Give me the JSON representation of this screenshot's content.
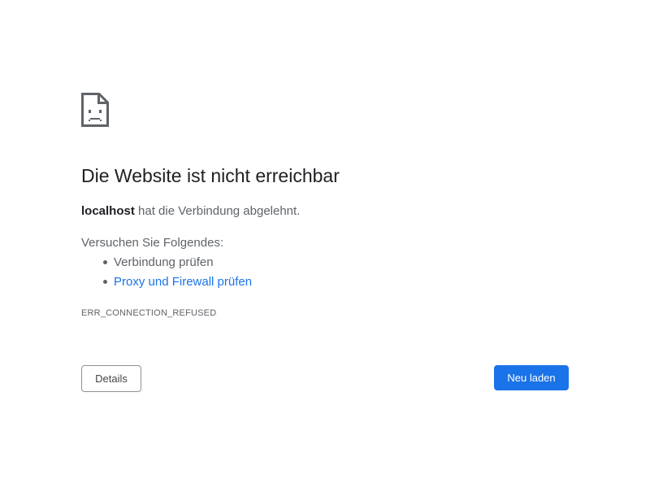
{
  "error_page": {
    "icon": "sad-document-icon",
    "title": "Die Website ist nicht erreichbar",
    "host": "localhost",
    "message_rest": " hat die Verbindung abgelehnt.",
    "suggestions_heading": "Versuchen Sie Folgendes:",
    "suggestions": [
      {
        "label": "Verbindung prüfen",
        "is_link": false
      },
      {
        "label": "Proxy und Firewall prüfen",
        "is_link": true
      }
    ],
    "error_code": "ERR_CONNECTION_REFUSED",
    "details_button": "Details",
    "reload_button": "Neu laden"
  },
  "colors": {
    "primary_blue": "#1a73e8",
    "text_dark": "#202124",
    "text_gray": "#5f6368"
  }
}
